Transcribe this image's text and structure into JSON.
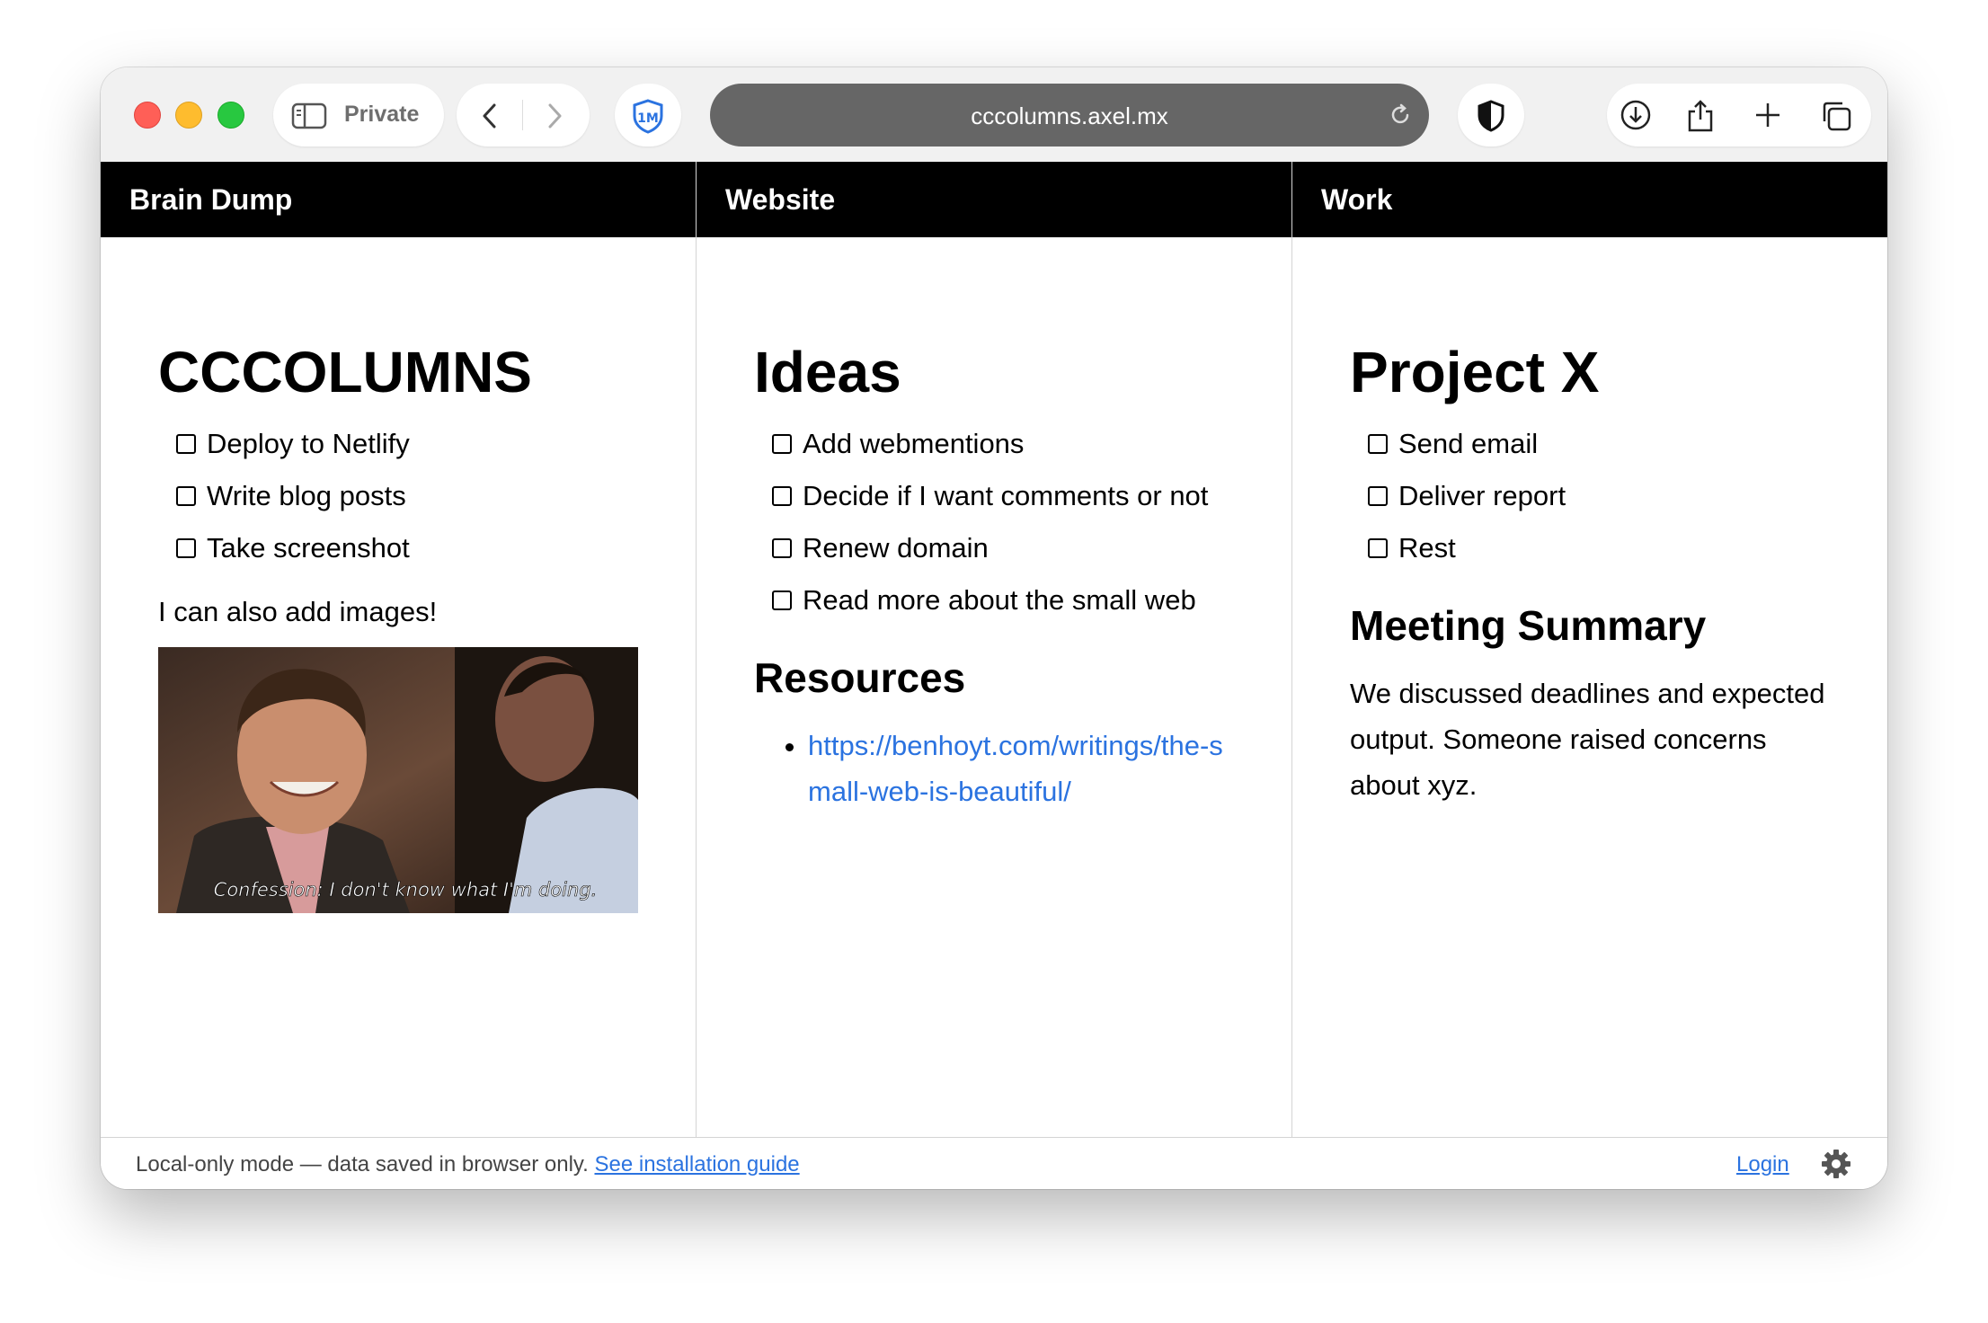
{
  "browser": {
    "private_label": "Private",
    "url": "cccolumns.axel.mx"
  },
  "columns": [
    {
      "header": "Brain Dump",
      "title": "CCCOLUMNS",
      "tasks": [
        "Deploy to Netlify",
        "Write blog posts",
        "Take screenshot"
      ],
      "note": "I can also add images!",
      "image_caption": "Confession: I don't know what I'm doing."
    },
    {
      "header": "Website",
      "title": "Ideas",
      "tasks": [
        "Add webmentions",
        "Decide if I want comments or not",
        "Renew domain",
        "Read more about the small web"
      ],
      "subtitle": "Resources",
      "links": [
        "https://benhoyt.com/writings/the-small-web-is-beautiful/"
      ]
    },
    {
      "header": "Work",
      "title": "Project X",
      "tasks": [
        "Send email",
        "Deliver report",
        "Rest"
      ],
      "subtitle": "Meeting Summary",
      "summary": "We discussed deadlines and expected output. Someone raised concerns about xyz."
    }
  ],
  "footer": {
    "message": "Local-only mode — data saved in browser only.",
    "guide_link": "See installation guide",
    "login": "Login"
  },
  "icons": {
    "sidebar": "sidebar-icon",
    "back": "chevron-left-icon",
    "forward": "chevron-right-icon",
    "extension": "extension-shield-icon",
    "reload": "reload-icon",
    "privacy": "privacy-shield-icon",
    "download": "download-icon",
    "share": "share-icon",
    "new_tab": "plus-icon",
    "tabs": "tabs-overview-icon",
    "settings": "gear-icon"
  },
  "colors": {
    "link": "#2b73e0",
    "header_bg": "#000000",
    "url_bar": "#666666"
  }
}
